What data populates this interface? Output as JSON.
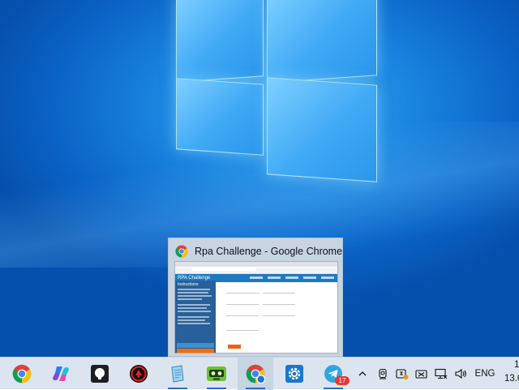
{
  "thumbnail": {
    "window_title": "Rpa Challenge - Google Chrome",
    "preview_app_name": "RPA Challenge",
    "preview_sidebar_heading": "Instructions"
  },
  "taskbar": {
    "apps": [
      {
        "name": "Google Chrome",
        "icon": "chrome-icon"
      },
      {
        "name": "Copilot",
        "icon": "copilot-icon"
      },
      {
        "name": "GitHub Desktop",
        "icon": "github-icon"
      },
      {
        "name": "Red app",
        "icon": "red-app-icon"
      },
      {
        "name": "Notepad",
        "icon": "notepad-icon"
      },
      {
        "name": "Robot",
        "icon": "robot-icon"
      },
      {
        "name": "Chrome (Rpa Challenge)",
        "icon": "chrome-active-icon"
      },
      {
        "name": "Settings",
        "icon": "settings-icon"
      },
      {
        "name": "Telegram",
        "icon": "telegram-icon",
        "badge": "17"
      }
    ],
    "tray": {
      "language": "ENG",
      "clock_time": "1",
      "clock_date": "13.0"
    }
  },
  "colors": {
    "taskbar_bg": "#dce5ef",
    "accent": "#2a6fc9",
    "desktop_blue": "#1a86e0"
  }
}
